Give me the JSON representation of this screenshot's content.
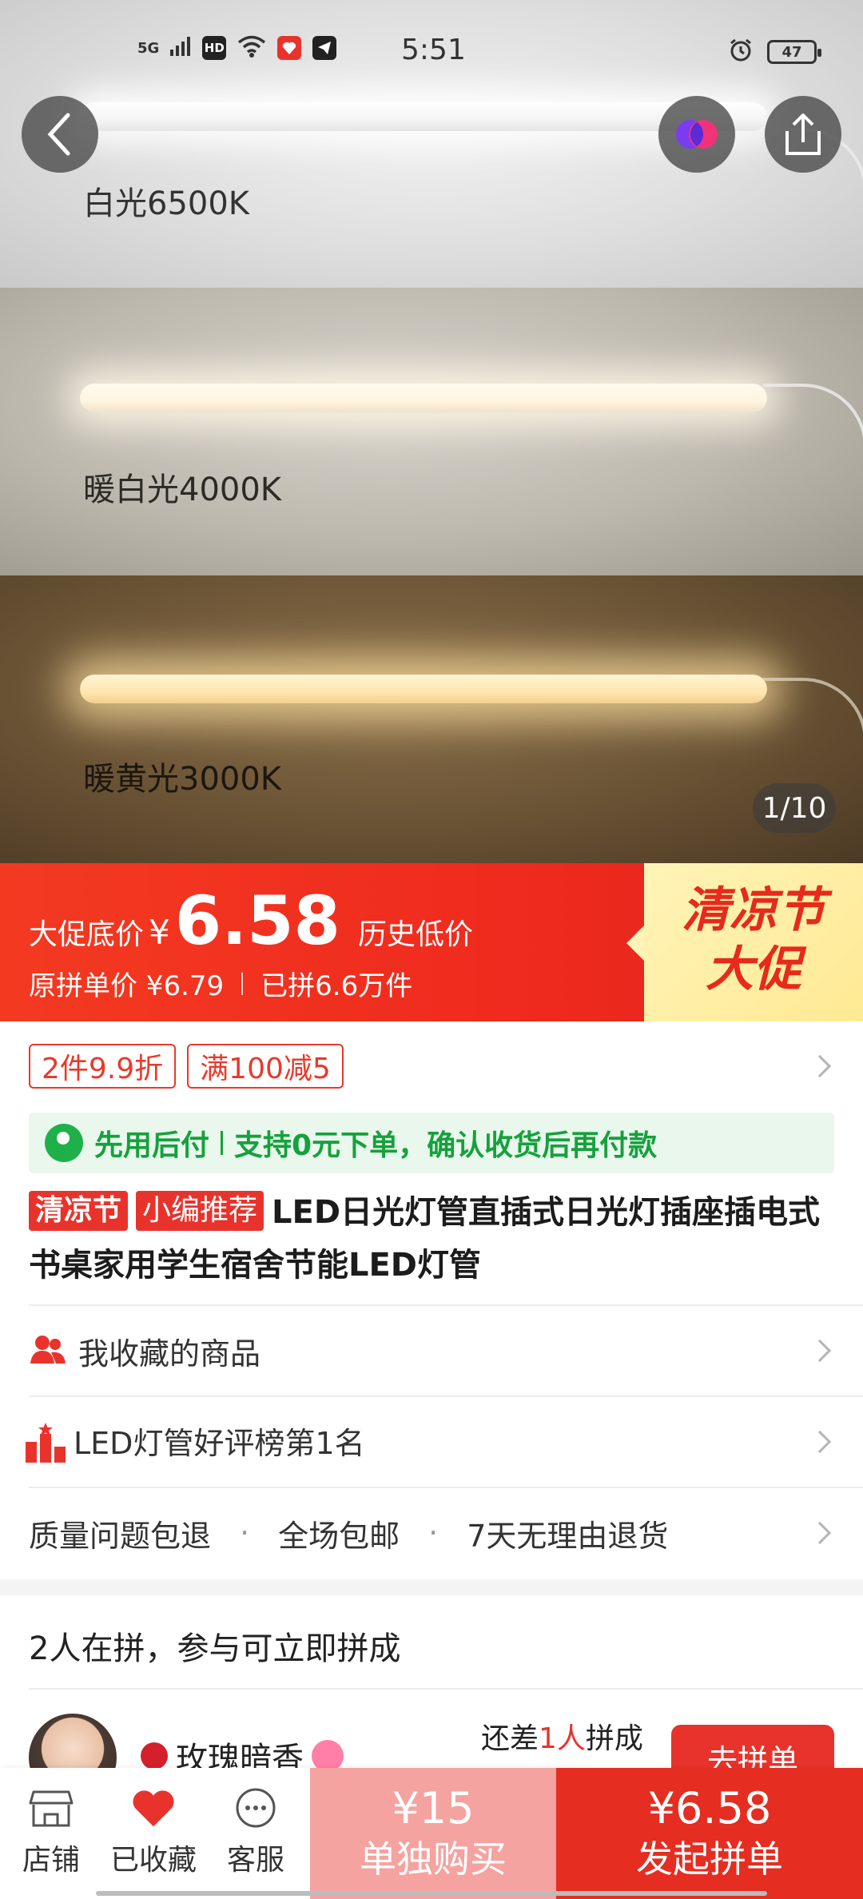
{
  "status_bar": {
    "network": "5G",
    "hd": "HD",
    "time": "5:51",
    "battery": "47"
  },
  "hero": {
    "bands": [
      {
        "label": "白光6500K"
      },
      {
        "label": "暖白光4000K"
      },
      {
        "label": "暖黄光3000K"
      }
    ],
    "image_counter": "1/10"
  },
  "price": {
    "promo_label": "大促底价",
    "currency": "¥",
    "promo_price": "6.58",
    "promo_tag": "历史低价",
    "original_text": "原拼单价 ¥6.79",
    "sold_text": "已拼6.6万件",
    "festival_line1": "清凉节",
    "festival_line2": "大促"
  },
  "coupons": [
    "2件9.9折",
    "满100减5"
  ],
  "pay_later": {
    "title": "先用后付",
    "desc": "支持0元下单，确认收货后再付款"
  },
  "product": {
    "tag1": "清凉节",
    "tag2": "小编推荐",
    "title": "LED日光灯管直插式日光灯插座插电式书桌家用学生宿舍节能LED灯管"
  },
  "rows": {
    "favorites": "我收藏的商品",
    "ranking": "LED灯管好评榜第1名",
    "guarantees": [
      "质量问题包退",
      "全场包邮",
      "7天无理由退货"
    ],
    "separator": "·"
  },
  "group_buy": {
    "title": "2人在拼，参与可立即拼成",
    "user_name": "玫瑰暗香",
    "need_prefix": "还差",
    "need_count": "1人",
    "need_suffix": "拼成",
    "join_label": "去拼单"
  },
  "bottom_bar": {
    "store": "店铺",
    "favorited": "已收藏",
    "service": "客服",
    "solo_price": "¥15",
    "solo_label": "单独购买",
    "group_price": "¥6.58",
    "group_label": "发起拼单"
  },
  "colors": {
    "accent_red": "#e8332c",
    "green": "#15a13d",
    "festival_bg": "#fff4b8"
  }
}
